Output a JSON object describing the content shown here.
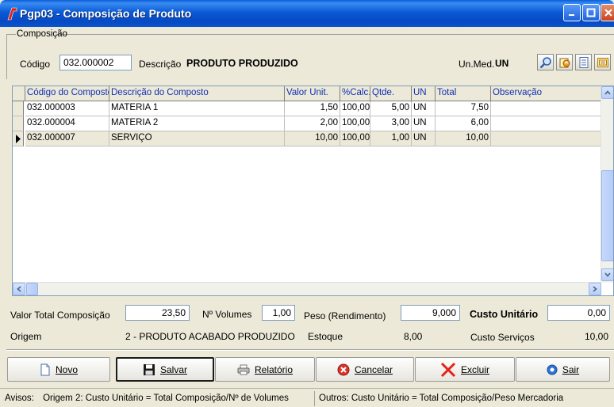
{
  "window": {
    "title": "Pgp03 - Composição de Produto"
  },
  "composicao": {
    "group_label": "Composição",
    "codigo_label": "Código",
    "codigo_value": "032.000002",
    "descricao_label": "Descrição",
    "descricao_value": "PRODUTO PRODUZIDO",
    "unmed_label": "Un.Med.",
    "unmed_value": "UN"
  },
  "grid": {
    "headers": [
      "Código do Composto",
      "Descrição do Composto",
      "Valor Unit.",
      "%Calc.",
      "Qtde.",
      "UN",
      "Total",
      "Observação"
    ],
    "rows": [
      [
        "032.000003",
        "MATERIA 1",
        "1,50",
        "100,00",
        "5,00",
        "UN",
        "7,50",
        ""
      ],
      [
        "032.000004",
        "MATERIA 2",
        "2,00",
        "100,00",
        "3,00",
        "UN",
        "6,00",
        ""
      ],
      [
        "032.000007",
        "SERVIÇO",
        "10,00",
        "100,00",
        "1,00",
        "UN",
        "10,00",
        ""
      ]
    ],
    "selected_row": 2
  },
  "totals": {
    "valor_total_label": "Valor Total Composição",
    "valor_total_value": "23,50",
    "volumes_label": "Nº Volumes",
    "volumes_value": "1,00",
    "peso_label": "Peso (Rendimento)",
    "peso_value": "9,000",
    "custo_unit_label": "Custo Unitário",
    "custo_unit_value": "0,00",
    "origem_label": "Origem",
    "origem_value": "2 - PRODUTO ACABADO PRODUZIDO",
    "estoque_label": "Estoque",
    "estoque_value": "8,00",
    "custo_servicos_label": "Custo Serviços",
    "custo_servicos_value": "10,00"
  },
  "buttons": {
    "novo": "Novo",
    "salvar": "Salvar",
    "relatorio": "Relatório",
    "cancelar": "Cancelar",
    "excluir": "Excluir",
    "sair": "Sair"
  },
  "status": {
    "avisos_label": "Avisos:",
    "msg1": "Origem 2: Custo Unitário = Total Composição/Nº de Volumes",
    "msg2": "Outros: Custo Unitário = Total Composição/Peso Mercadoria"
  },
  "colors": {
    "title_blue": "#0b5ad4",
    "header_text": "#0f2fb5",
    "close_red": "#c9431d"
  },
  "icons": [
    "app-icon",
    "search-icon",
    "refresh-icon",
    "document-icon",
    "export-icon",
    "new-document-icon",
    "save-icon",
    "printer-icon",
    "cancel-icon",
    "delete-x-icon",
    "exit-icon"
  ]
}
